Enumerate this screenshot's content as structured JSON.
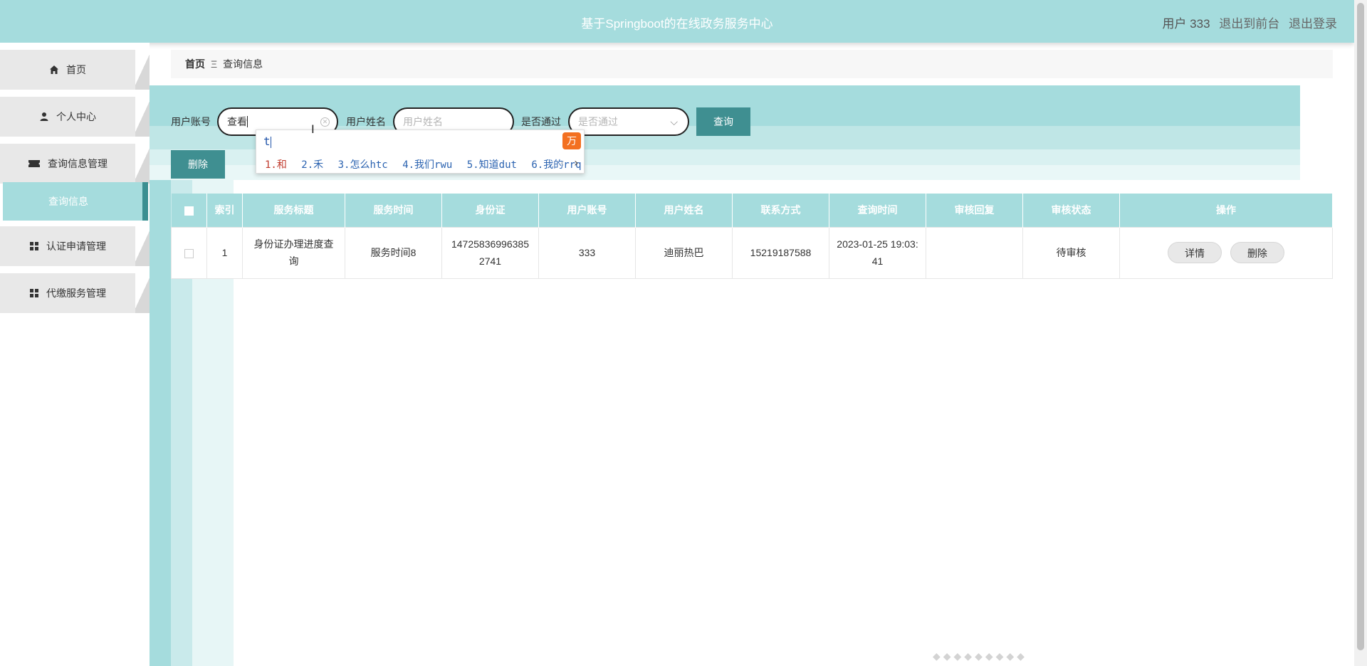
{
  "header": {
    "title": "基于Springboot的在线政务服务中心",
    "user": "用户 333",
    "back_to_front": "退出到前台",
    "logout": "退出登录"
  },
  "sidebar": {
    "items": [
      {
        "label": "首页",
        "icon": "home-icon"
      },
      {
        "label": "个人中心",
        "icon": "user-icon"
      },
      {
        "label": "查询信息管理",
        "icon": "ticket-icon"
      },
      {
        "label": "认证申请管理",
        "icon": "grid-icon"
      },
      {
        "label": "代缴服务管理",
        "icon": "grid-icon"
      }
    ],
    "submenu_active": "查询信息"
  },
  "breadcrumb": {
    "home": "首页",
    "separator": "Ξ",
    "current": "查询信息"
  },
  "search": {
    "account_label": "用户账号",
    "account_value": "查看",
    "name_label": "用户姓名",
    "name_placeholder": "用户姓名",
    "pass_label": "是否通过",
    "pass_placeholder": "是否通过",
    "query_button": "查询",
    "delete_button": "删除"
  },
  "ime": {
    "composition": "t",
    "logo": "万",
    "candidates": [
      "1.和",
      "2.禾",
      "3.怎么htc",
      "4.我们rwu",
      "5.知道dut",
      "6.我的rrq"
    ]
  },
  "table": {
    "headers": [
      "索引",
      "服务标题",
      "服务时间",
      "身份证",
      "用户账号",
      "用户姓名",
      "联系方式",
      "查询时间",
      "审核回复",
      "审核状态",
      "操作"
    ],
    "rows": [
      {
        "index": "1",
        "title": "身份证办理进度查询",
        "service_time": "服务时间8",
        "id_card": "147258369963852741",
        "account": "333",
        "name": "迪丽热巴",
        "phone": "15219187588",
        "query_time": "2023-01-25 19:03:41",
        "reply": "",
        "status": "待审核",
        "detail_button": "详情",
        "delete_button": "删除"
      }
    ]
  },
  "colors": {
    "header_bg": "#a5dcdd",
    "accent_dark": "#3f8f91"
  }
}
